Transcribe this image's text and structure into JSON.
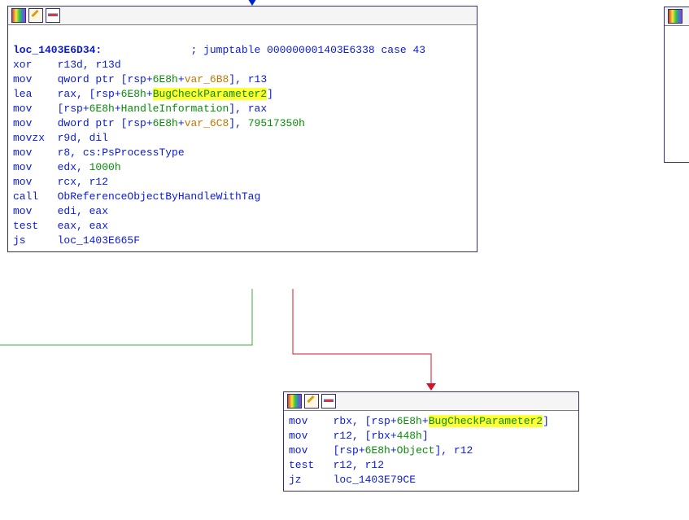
{
  "nodes": {
    "main": {
      "label": "loc_1403E6D34:",
      "comment": "; jumptable 000000001403E6338 case 43",
      "lines": [
        {
          "mnem": "xor",
          "parts": [
            {
              "k": "reg",
              "t": "r13d"
            },
            {
              "k": "punct",
              "t": ", "
            },
            {
              "k": "reg",
              "t": "r13d"
            }
          ]
        },
        {
          "mnem": "mov",
          "parts": [
            {
              "k": "brk",
              "t": "qword ptr ["
            },
            {
              "k": "reg",
              "t": "rsp"
            },
            {
              "k": "brk",
              "t": "+"
            },
            {
              "k": "num",
              "t": "6E8h"
            },
            {
              "k": "brk",
              "t": "+"
            },
            {
              "k": "var",
              "t": "var_6B8"
            },
            {
              "k": "brk",
              "t": "]"
            },
            {
              "k": "punct",
              "t": ", "
            },
            {
              "k": "reg",
              "t": "r13"
            }
          ]
        },
        {
          "mnem": "lea",
          "parts": [
            {
              "k": "reg",
              "t": "rax"
            },
            {
              "k": "punct",
              "t": ", "
            },
            {
              "k": "brk",
              "t": "["
            },
            {
              "k": "reg",
              "t": "rsp"
            },
            {
              "k": "brk",
              "t": "+"
            },
            {
              "k": "num",
              "t": "6E8h"
            },
            {
              "k": "brk",
              "t": "+"
            },
            {
              "k": "hl",
              "t": "BugCheckParameter2"
            },
            {
              "k": "brk",
              "t": "]"
            }
          ]
        },
        {
          "mnem": "mov",
          "parts": [
            {
              "k": "brk",
              "t": "["
            },
            {
              "k": "reg",
              "t": "rsp"
            },
            {
              "k": "brk",
              "t": "+"
            },
            {
              "k": "num",
              "t": "6E8h"
            },
            {
              "k": "brk",
              "t": "+"
            },
            {
              "k": "num",
              "t": "HandleInformation"
            },
            {
              "k": "brk",
              "t": "]"
            },
            {
              "k": "punct",
              "t": ", "
            },
            {
              "k": "reg",
              "t": "rax"
            }
          ]
        },
        {
          "mnem": "mov",
          "parts": [
            {
              "k": "brk",
              "t": "dword ptr ["
            },
            {
              "k": "reg",
              "t": "rsp"
            },
            {
              "k": "brk",
              "t": "+"
            },
            {
              "k": "num",
              "t": "6E8h"
            },
            {
              "k": "brk",
              "t": "+"
            },
            {
              "k": "var",
              "t": "var_6C8"
            },
            {
              "k": "brk",
              "t": "]"
            },
            {
              "k": "punct",
              "t": ", "
            },
            {
              "k": "num",
              "t": "79517350h"
            }
          ]
        },
        {
          "mnem": "movzx",
          "parts": [
            {
              "k": "reg",
              "t": "r9d"
            },
            {
              "k": "punct",
              "t": ", "
            },
            {
              "k": "reg",
              "t": "dil"
            }
          ]
        },
        {
          "mnem": "mov",
          "parts": [
            {
              "k": "reg",
              "t": "r8"
            },
            {
              "k": "punct",
              "t": ", "
            },
            {
              "k": "brk",
              "t": "cs:"
            },
            {
              "k": "sym",
              "t": "PsProcessType"
            }
          ]
        },
        {
          "mnem": "mov",
          "parts": [
            {
              "k": "reg",
              "t": "edx"
            },
            {
              "k": "punct",
              "t": ", "
            },
            {
              "k": "num",
              "t": "1000h"
            }
          ]
        },
        {
          "mnem": "mov",
          "parts": [
            {
              "k": "reg",
              "t": "rcx"
            },
            {
              "k": "punct",
              "t": ", "
            },
            {
              "k": "reg",
              "t": "r12"
            }
          ]
        },
        {
          "mnem": "call",
          "parts": [
            {
              "k": "sym",
              "t": "ObReferenceObjectByHandleWithTag"
            }
          ]
        },
        {
          "mnem": "mov",
          "parts": [
            {
              "k": "reg",
              "t": "edi"
            },
            {
              "k": "punct",
              "t": ", "
            },
            {
              "k": "reg",
              "t": "eax"
            }
          ]
        },
        {
          "mnem": "test",
          "parts": [
            {
              "k": "reg",
              "t": "eax"
            },
            {
              "k": "punct",
              "t": ", "
            },
            {
              "k": "reg",
              "t": "eax"
            }
          ]
        },
        {
          "mnem": "js",
          "parts": [
            {
              "k": "sym",
              "t": "loc_1403E665F"
            }
          ]
        }
      ]
    },
    "sub": {
      "lines": [
        {
          "mnem": "mov",
          "parts": [
            {
              "k": "reg",
              "t": "rbx"
            },
            {
              "k": "punct",
              "t": ", "
            },
            {
              "k": "brk",
              "t": "["
            },
            {
              "k": "reg",
              "t": "rsp"
            },
            {
              "k": "brk",
              "t": "+"
            },
            {
              "k": "num",
              "t": "6E8h"
            },
            {
              "k": "brk",
              "t": "+"
            },
            {
              "k": "hl",
              "t": "BugCheckParameter2"
            },
            {
              "k": "brk",
              "t": "]"
            }
          ]
        },
        {
          "mnem": "mov",
          "parts": [
            {
              "k": "reg",
              "t": "r12"
            },
            {
              "k": "punct",
              "t": ", "
            },
            {
              "k": "brk",
              "t": "["
            },
            {
              "k": "reg",
              "t": "rbx"
            },
            {
              "k": "brk",
              "t": "+"
            },
            {
              "k": "num",
              "t": "448h"
            },
            {
              "k": "brk",
              "t": "]"
            }
          ]
        },
        {
          "mnem": "mov",
          "parts": [
            {
              "k": "brk",
              "t": "["
            },
            {
              "k": "reg",
              "t": "rsp"
            },
            {
              "k": "brk",
              "t": "+"
            },
            {
              "k": "num",
              "t": "6E8h"
            },
            {
              "k": "brk",
              "t": "+"
            },
            {
              "k": "num",
              "t": "Object"
            },
            {
              "k": "brk",
              "t": "]"
            },
            {
              "k": "punct",
              "t": ", "
            },
            {
              "k": "reg",
              "t": "r12"
            }
          ]
        },
        {
          "mnem": "test",
          "parts": [
            {
              "k": "reg",
              "t": "r12"
            },
            {
              "k": "punct",
              "t": ", "
            },
            {
              "k": "reg",
              "t": "r12"
            }
          ]
        },
        {
          "mnem": "jz",
          "parts": [
            {
              "k": "sym",
              "t": "loc_1403E79CE"
            }
          ]
        }
      ]
    }
  }
}
